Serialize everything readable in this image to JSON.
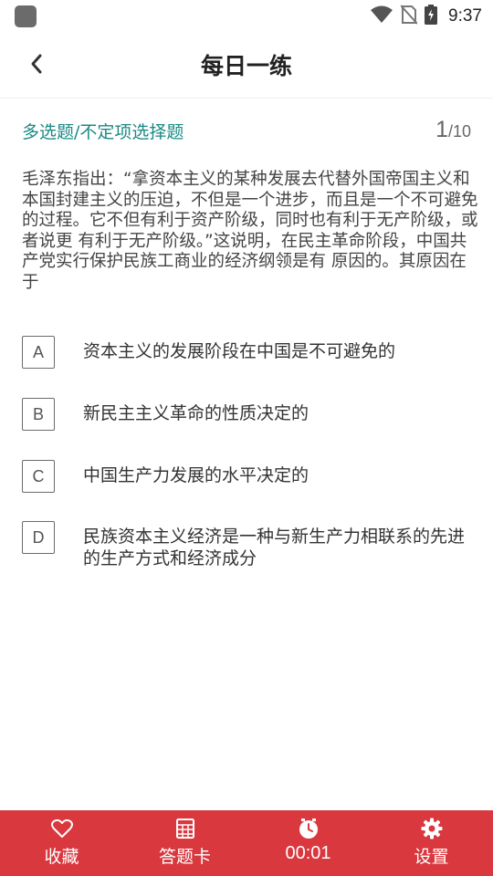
{
  "status_bar": {
    "time": "9:37"
  },
  "header": {
    "title": "每日一练"
  },
  "question": {
    "type": "多选题/不定项选择题",
    "current": "1",
    "total": "/10",
    "text": "毛泽东指出：“拿资本主义的某种发展去代替外国帝国主义和本国封建主义的压迫，不但是一个进步，而且是一个不可避免的过程。它不但有利于资产阶级，同时也有利于无产阶级，或者说更 有利于无产阶级。”这说明，在民主革命阶段，中国共产党实行保护民族工商业的经济纲领是有 原因的。其原因在于",
    "options": [
      {
        "letter": "A",
        "text": "资本主义的发展阶段在中国是不可避免的"
      },
      {
        "letter": "B",
        "text": "新民主主义革命的性质决定的"
      },
      {
        "letter": "C",
        "text": "中国生产力发展的水平决定的"
      },
      {
        "letter": "D",
        "text": "民族资本主义经济是一种与新生产力相联系的先进的生产方式和经济成分"
      }
    ]
  },
  "bottom_bar": {
    "favorite_label": "收藏",
    "answer_card_label": "答题卡",
    "timer_label": "00:01",
    "settings_label": "设置"
  },
  "colors": {
    "accent_teal": "#1a8a84",
    "bottom_bar_red": "#d9383e"
  },
  "icons": [
    "back-arrow-icon",
    "heart-icon",
    "grid-icon",
    "clock-icon",
    "gear-icon",
    "wifi-icon",
    "no-sim-icon",
    "battery-charging-icon"
  ]
}
